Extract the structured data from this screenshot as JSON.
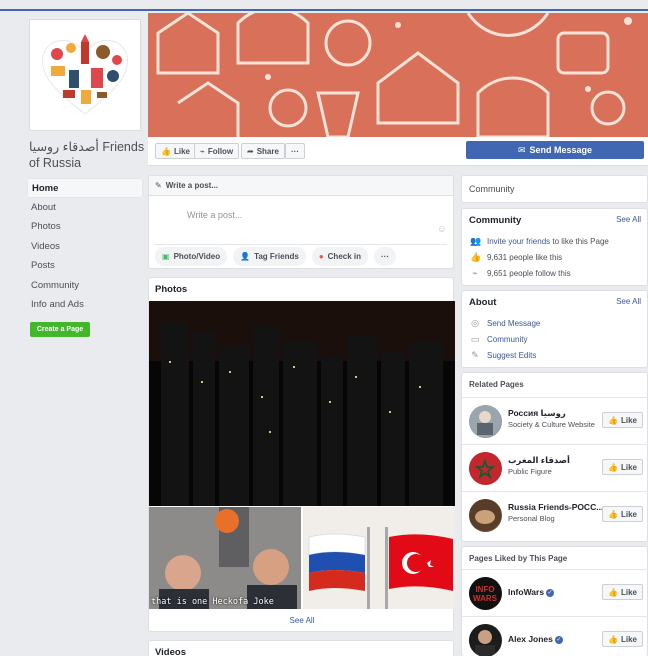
{
  "page": {
    "name": "أصدقاء روسيا Friends of Russia"
  },
  "nav": {
    "items": [
      "Home",
      "About",
      "Photos",
      "Videos",
      "Posts",
      "Community",
      "Info and Ads"
    ],
    "create_page": "Create a Page"
  },
  "actions": {
    "like": "Like",
    "follow": "Follow",
    "share": "Share",
    "more": "···",
    "send_message": "Send Message"
  },
  "composer": {
    "header": "Write a post...",
    "placeholder": "Write a post...",
    "photo_video": "Photo/Video",
    "tag_friends": "Tag Friends",
    "check_in": "Check in",
    "more": "···"
  },
  "photos": {
    "title": "Photos",
    "caption": "that is one Heckofa Joke",
    "see_all": "See All"
  },
  "videos": {
    "title": "Videos"
  },
  "right": {
    "community_tab": "Community",
    "community": {
      "title": "Community",
      "see_all": "See All",
      "invite_link": "Invite your friends",
      "invite_rest": " to like this Page",
      "likes": "9,631 people like this",
      "follows": "9,651 people follow this"
    },
    "about": {
      "title": "About",
      "see_all": "See All",
      "send_message": "Send Message",
      "community": "Community",
      "suggest_edits": "Suggest Edits"
    },
    "related": {
      "title": "Related Pages",
      "items": [
        {
          "name": "Россия روسيا",
          "sub": "Society & Culture Website"
        },
        {
          "name": "أصدقاء المغرب",
          "sub": "Public Figure"
        },
        {
          "name": "Russia Friends-РОСС...",
          "sub": "Personal Blog"
        }
      ],
      "like": "Like"
    },
    "liked": {
      "title": "Pages Liked by This Page",
      "items": [
        {
          "name": "InfoWars"
        },
        {
          "name": "Alex Jones"
        }
      ],
      "like": "Like"
    }
  },
  "colors": {
    "brand": "#4267b2",
    "cover": "#d9705a",
    "create": "#42b72a"
  }
}
